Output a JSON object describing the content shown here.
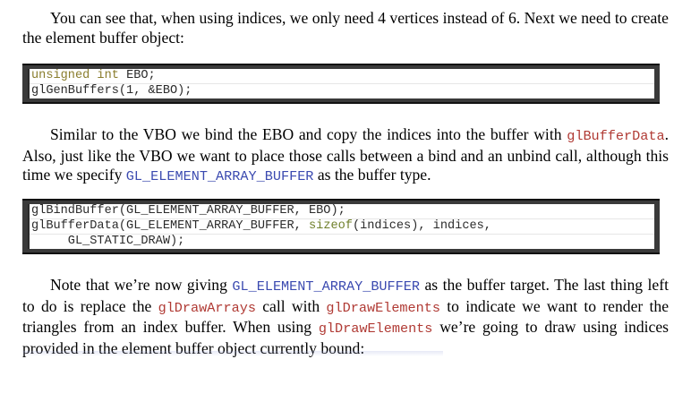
{
  "paragraph1": {
    "text": "You can see that, when using indices, we only need 4 vertices instead of 6. Next we need to create the element buffer object:"
  },
  "code1": {
    "line1_kw": "unsigned int",
    "line1_rest": " EBO;",
    "line2": "glGenBuffers(1, &EBO);"
  },
  "paragraph2": {
    "part1": "Similar to the VBO we bind the EBO and copy the indices into the buffer with ",
    "code1": "glBufferData",
    "part2": ". Also, just like the VBO we want to place those calls between a bind and an unbind call, although this time we specify ",
    "code2": "GL_ELEMENT_ARRAY_BUFFER",
    "part3": " as the buffer type."
  },
  "code2": {
    "line1": "glBindBuffer(GL_ELEMENT_ARRAY_BUFFER, EBO);",
    "line2_a": "glBufferData(GL_ELEMENT_ARRAY_BUFFER, ",
    "line2_kw": "sizeof",
    "line2_b": "(indices), indices,",
    "line3": "     GL_STATIC_DRAW);"
  },
  "paragraph3": {
    "part1": "Note that we’re now giving ",
    "code1": "GL_ELEMENT_ARRAY_BUFFER",
    "part2": " as the buffer target.  The last thing left to do is replace the ",
    "code2": "glDrawArrays",
    "part3": " call with ",
    "code3": "glDrawElements",
    "part4": " to indicate we want to render the triangles from an index buffer. When using ",
    "code4": "glDrawElements",
    "part5": " we’re going to draw using indices provided in the element buffer object currently bound:"
  },
  "colors": {
    "inline_code_red": "#b03a34",
    "inline_code_blue": "#3b4ab0",
    "code_keyword": "#8a7d2d",
    "code_frame": "#3a3a3a"
  }
}
